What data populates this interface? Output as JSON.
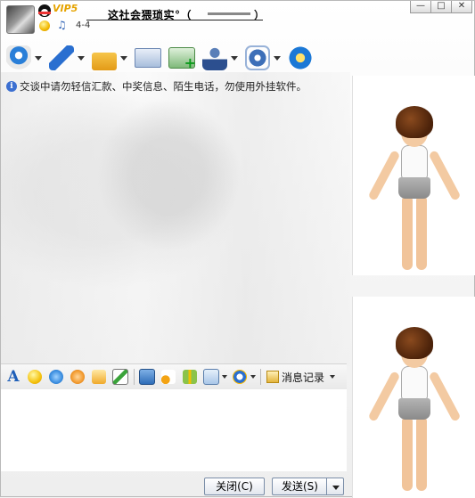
{
  "titlebar": {
    "vip_label": "VIP5",
    "title": "这社会猥琐实°（",
    "title_end": "）",
    "song_count": "4-4",
    "minimize_glyph": "—",
    "maximize_glyph": "□",
    "close_glyph": "✕"
  },
  "toolbar": {
    "tools": [
      {
        "icon": "webcam-icon",
        "has_dropdown": true
      },
      {
        "icon": "microphone-icon",
        "has_dropdown": true
      },
      {
        "icon": "send-file-icon",
        "has_dropdown": true
      },
      {
        "icon": "mail-icon",
        "has_dropdown": false
      },
      {
        "icon": "add-app-icon",
        "has_dropdown": false
      },
      {
        "icon": "user-info-icon",
        "has_dropdown": true
      },
      {
        "icon": "settings-gear-icon",
        "has_dropdown": true
      },
      {
        "icon": "app-launcher-icon",
        "has_dropdown": false
      }
    ]
  },
  "notice": {
    "text": "交谈中请勿轻信汇款、中奖信息、陌生电话，勿使用外挂软件。"
  },
  "format_bar": {
    "font_glyph": "A",
    "message_record_label": "消息记录"
  },
  "buttons": {
    "close_label": "关闭(C)",
    "send_label": "发送(S)"
  },
  "colors": {
    "accent_blue": "#2a6fd0",
    "vip_gold": "#e5a300",
    "panel_bg": "#ffffff"
  }
}
